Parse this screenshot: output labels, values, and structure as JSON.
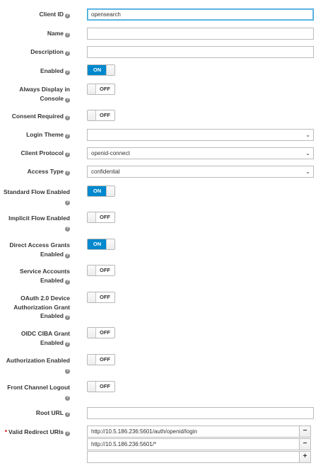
{
  "form": {
    "client_id": {
      "label": "Client ID",
      "value": "opensearch"
    },
    "name": {
      "label": "Name",
      "value": ""
    },
    "description": {
      "label": "Description",
      "value": ""
    },
    "enabled": {
      "label": "Enabled",
      "state": "ON"
    },
    "always_display": {
      "label_1": "Always Display in",
      "label_2": "Console",
      "state": "OFF"
    },
    "consent_required": {
      "label": "Consent Required",
      "state": "OFF"
    },
    "login_theme": {
      "label": "Login Theme",
      "value": ""
    },
    "client_protocol": {
      "label": "Client Protocol",
      "value": "openid-connect"
    },
    "access_type": {
      "label": "Access Type",
      "value": "confidential"
    },
    "standard_flow": {
      "label": "Standard Flow Enabled",
      "state": "ON"
    },
    "implicit_flow": {
      "label": "Implicit Flow Enabled",
      "state": "OFF"
    },
    "direct_access": {
      "label_1": "Direct Access Grants",
      "label_2": "Enabled",
      "state": "ON"
    },
    "service_accounts": {
      "label_1": "Service Accounts",
      "label_2": "Enabled",
      "state": "OFF"
    },
    "oauth_device": {
      "label_1": "OAuth 2.0 Device",
      "label_2": "Authorization Grant",
      "label_3": "Enabled",
      "state": "OFF"
    },
    "oidc_ciba": {
      "label_1": "OIDC CIBA Grant",
      "label_2": "Enabled",
      "state": "OFF"
    },
    "authorization": {
      "label": "Authorization Enabled",
      "state": "OFF"
    },
    "front_channel": {
      "label": "Front Channel Logout",
      "state": "OFF"
    },
    "root_url": {
      "label": "Root URL",
      "value": ""
    },
    "redirect_uris": {
      "label": "Valid Redirect URIs",
      "required_mark": "*",
      "values": [
        "http://10.5.186.236:5601/auth/openid/login",
        "http://10.5.186.236:5601/*",
        ""
      ],
      "remove_label": "−",
      "add_label": "+"
    }
  },
  "icons": {
    "help": "question-circle-icon",
    "dropdown": "chevron-down-icon"
  },
  "colors": {
    "toggle_on": "#0088ce",
    "focus_border": "#39a5dc",
    "required": "#cc0000"
  }
}
